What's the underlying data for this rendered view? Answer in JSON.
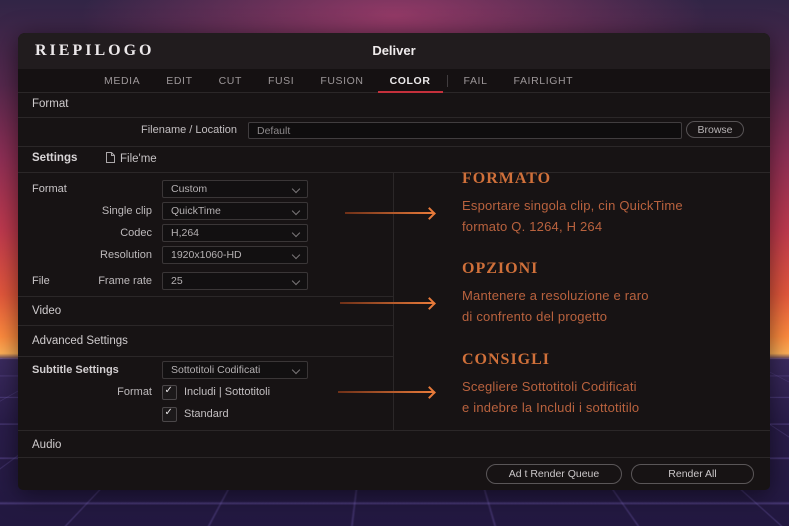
{
  "window": {
    "brand": "RIEPILOGO",
    "title": "Deliver"
  },
  "tabs": [
    {
      "label": "MEDIA"
    },
    {
      "label": "EDIT"
    },
    {
      "label": "CUT"
    },
    {
      "label": "FUSI"
    },
    {
      "label": "FUSION"
    },
    {
      "label": "COLOR"
    },
    {
      "label": "FAIL"
    },
    {
      "label": "FAIRLIGHT"
    }
  ],
  "format_section": {
    "header": "Format",
    "filename_label": "Filename / Location",
    "filename_value": "Default",
    "browse_label": "Browse"
  },
  "settings": {
    "title": "Settings",
    "file_chip": "File'me",
    "rows": [
      {
        "group": "Format",
        "label": "",
        "value": "Custom"
      },
      {
        "group": "",
        "label": "Single clip",
        "value": "QuickTime"
      },
      {
        "group": "",
        "label": "Codec",
        "value": "H,264"
      },
      {
        "group": "",
        "label": "Resolution",
        "value": "1920x1060-HD"
      },
      {
        "group": "File",
        "label": "Frame rate",
        "value": "25"
      }
    ],
    "section_video": "Video",
    "section_advanced": "Advanced Settings",
    "subtitle": {
      "label": "Subtitle Settings",
      "value": "Sottotitoli Codificati",
      "format_label": "Format",
      "checkboxes": [
        "Includi | Sottotitoli",
        "Standard"
      ]
    },
    "audio_label": "Audio"
  },
  "annotations": [
    {
      "title": "FORMATO",
      "lines": [
        "Esportare singola clip, cin QuickTime",
        "formato Q. 1264, H 264"
      ]
    },
    {
      "title": "OPZIONI",
      "lines": [
        "Mantenere a resoluzione e raro",
        "di confrento del progetto"
      ]
    },
    {
      "title": "CONSIGLI",
      "lines": [
        "Scegliere Sottotitoli Codificati",
        "e indebre la Includi i sottotitilo"
      ]
    }
  ],
  "footer": {
    "add_label": "Ad t Render Queue",
    "render_label": "Render All"
  },
  "colors": {
    "accent_red": "#c5303c",
    "annotation_orange": "#d0703a",
    "arrow_orange": "#e87a3a"
  }
}
